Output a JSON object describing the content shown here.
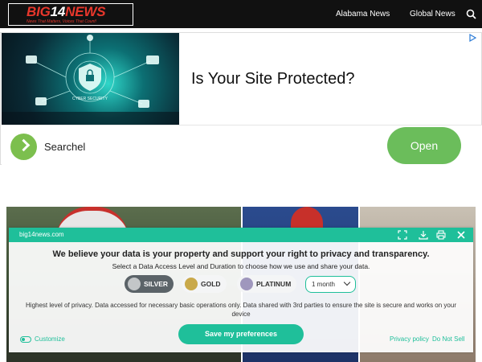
{
  "header": {
    "logo": {
      "big": "BIG",
      "num": "14",
      "news": "NEWS",
      "tagline": "News That Matters, Voices That Count!"
    },
    "nav": [
      "Alabama News",
      "Global News"
    ]
  },
  "ad": {
    "image_caption": "CYBER SECURITY",
    "headline": "Is Your Site Protected?",
    "brand": "Searchel",
    "brand_logo_text": "SEARCHEL",
    "cta": "Open"
  },
  "consent": {
    "domain": "big14news.com",
    "title": "We believe your data is your property and support your right to privacy and transparency.",
    "subtitle": "Select a Data Access Level and Duration to choose how we use and share your data.",
    "levels": [
      "SILVER",
      "GOLD",
      "PLATINUM"
    ],
    "selected_level": "SILVER",
    "duration": "1 month",
    "description": "Highest level of privacy. Data accessed for necessary basic operations only. Data shared with 3rd parties to ensure the site is secure and works on your device",
    "customize": "Customize",
    "save": "Save my preferences",
    "privacy_policy": "Privacy policy",
    "do_not_sell": "Do Not Sell"
  },
  "colors": {
    "accent": "#1fbf9a",
    "header_bg": "#111111",
    "logo_red": "#e8372c",
    "ad_cta": "#6bbd5b"
  }
}
